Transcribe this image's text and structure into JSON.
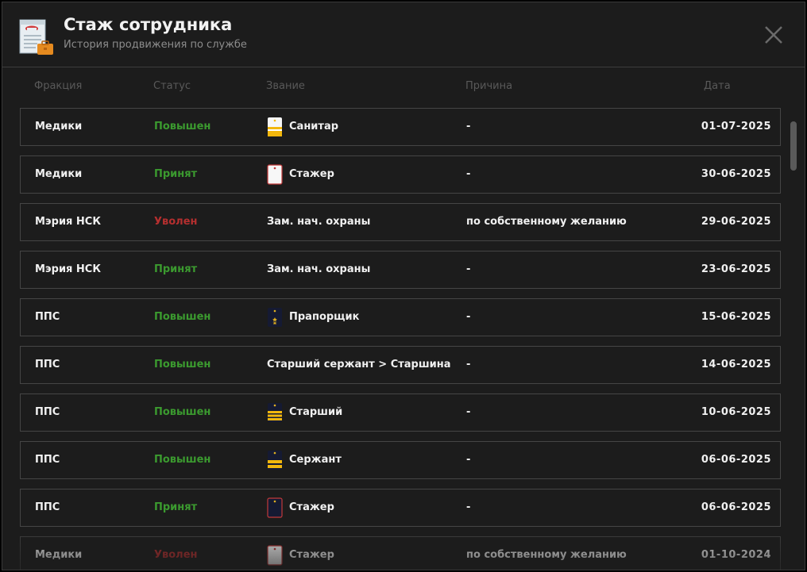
{
  "header": {
    "title": "Стаж сотрудника",
    "subtitle": "История продвижения по службе",
    "icon": "document-briefcase-icon"
  },
  "columns": {
    "faction": "Фракция",
    "status": "Статус",
    "rank": "Звание",
    "reason": "Причина",
    "date": "Дата"
  },
  "colors": {
    "promoted": "#3b9a2f",
    "hired": "#3b9a2f",
    "fired": "#b52f2f",
    "border": "#454545",
    "background": "#1c1c1c"
  },
  "rows": [
    {
      "faction": "Медики",
      "status": "Повышен",
      "status_type": "promoted",
      "rank": "Санитар",
      "rank_icon": "medic-strap-yellow-icon",
      "reason": "-",
      "date": "01-07-2025"
    },
    {
      "faction": "Медики",
      "status": "Принят",
      "status_type": "hired",
      "rank": "Стажер",
      "rank_icon": "medic-strap-blank-icon",
      "reason": "-",
      "date": "30-06-2025"
    },
    {
      "faction": "Мэрия НСК",
      "status": "Уволен",
      "status_type": "fired",
      "rank": "Зам. нач. охраны",
      "rank_icon": "",
      "reason": "по собственному желанию",
      "date": "29-06-2025"
    },
    {
      "faction": "Мэрия НСК",
      "status": "Принят",
      "status_type": "hired",
      "rank": "Зам. нач. охраны",
      "rank_icon": "",
      "reason": "-",
      "date": "23-06-2025"
    },
    {
      "faction": "ППС",
      "status": "Повышен",
      "status_type": "promoted",
      "rank": "Прапорщик",
      "rank_icon": "police-strap-praporshchik-icon",
      "reason": "-",
      "date": "15-06-2025"
    },
    {
      "faction": "ППС",
      "status": "Повышен",
      "status_type": "promoted",
      "rank": "Старший сержант > Старшина",
      "rank_icon": "",
      "reason": "-",
      "date": "14-06-2025"
    },
    {
      "faction": "ППС",
      "status": "Повышен",
      "status_type": "promoted",
      "rank": "Старший",
      "rank_icon": "police-strap-three-stripes-icon",
      "reason": "-",
      "date": "10-06-2025"
    },
    {
      "faction": "ППС",
      "status": "Повышен",
      "status_type": "promoted",
      "rank": "Сержант",
      "rank_icon": "police-strap-two-stripes-icon",
      "reason": "-",
      "date": "06-06-2025"
    },
    {
      "faction": "ППС",
      "status": "Принят",
      "status_type": "hired",
      "rank": "Стажер",
      "rank_icon": "police-strap-blank-icon",
      "reason": "-",
      "date": "06-06-2025"
    },
    {
      "faction": "Медики",
      "status": "Уволен",
      "status_type": "fired",
      "rank": "Стажер",
      "rank_icon": "medic-strap-blank-icon",
      "reason": "по собственному желанию",
      "date": "01-10-2024"
    }
  ],
  "scrollbar": {
    "position_fraction": 0.0
  }
}
